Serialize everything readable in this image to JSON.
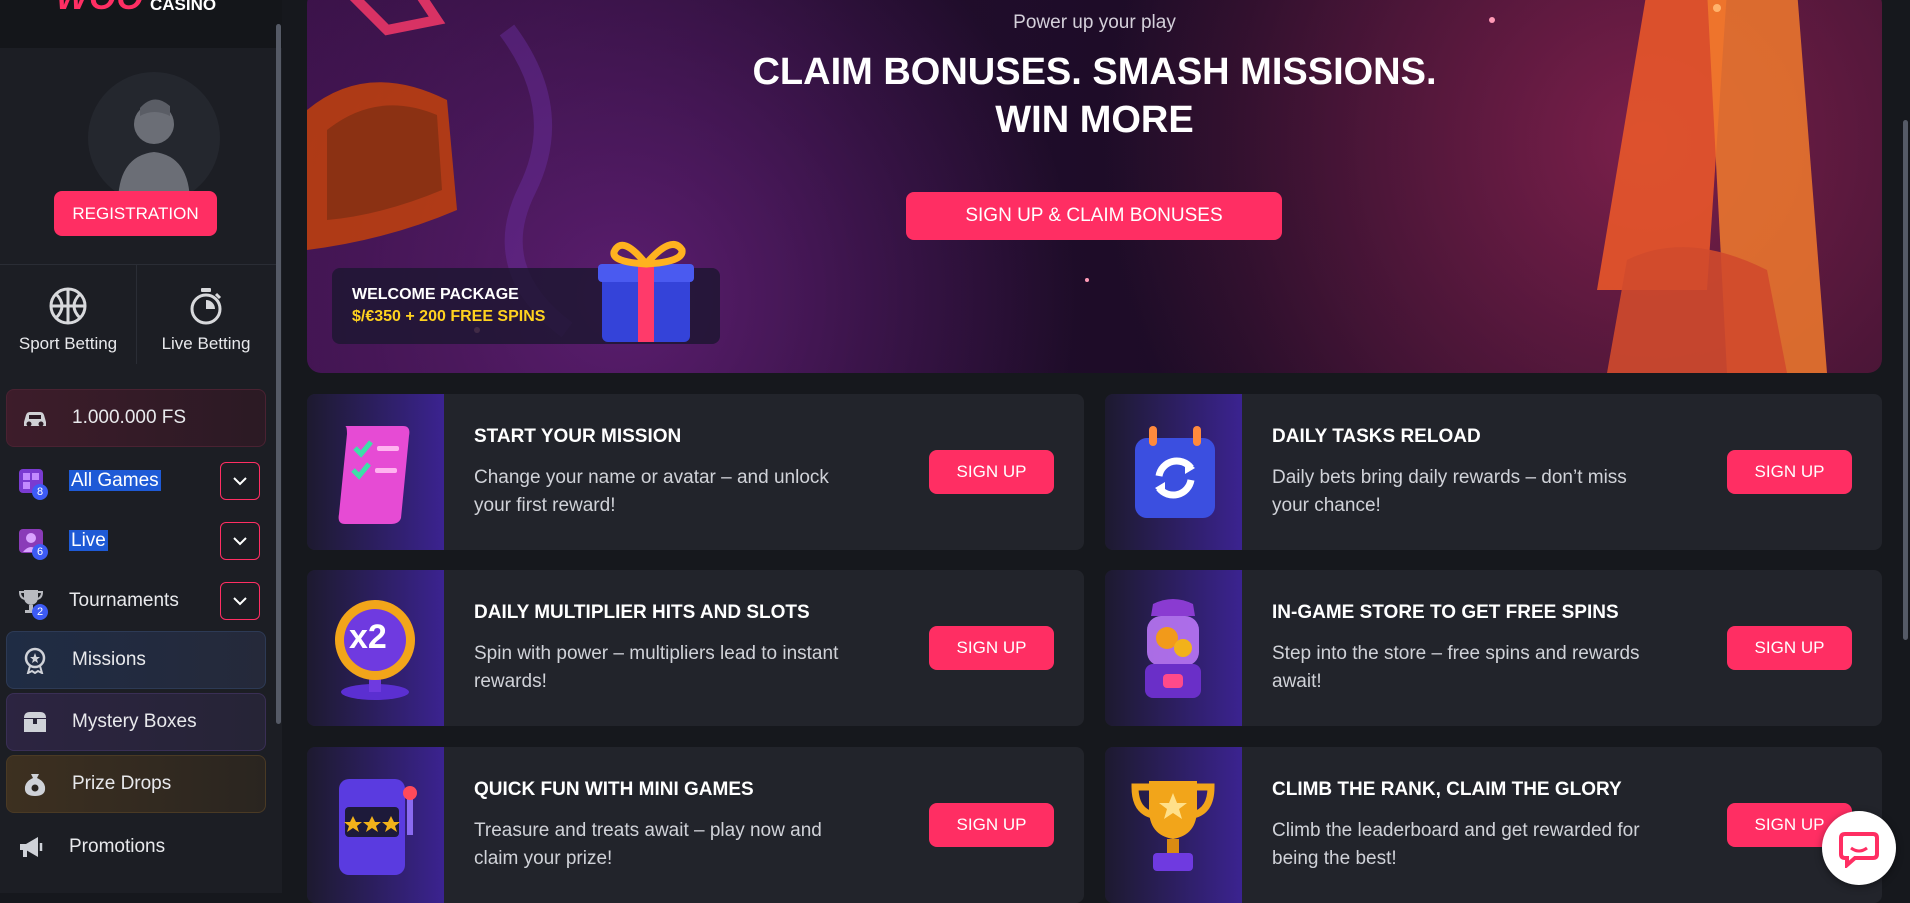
{
  "sidebar": {
    "logo_main": "WOO",
    "logo_sub": "CASINO",
    "registration_label": "REGISTRATION",
    "betting": [
      {
        "label": "Sport Betting",
        "icon": "basketball-icon"
      },
      {
        "label": "Live Betting",
        "icon": "stopwatch-icon"
      }
    ],
    "items": [
      {
        "label": "1.000.000 FS",
        "icon": "car-icon"
      },
      {
        "label": "All Games",
        "icon": "games-icon",
        "badge": "8",
        "selected": true
      },
      {
        "label": "Live",
        "icon": "live-icon",
        "badge": "6",
        "selected": true
      },
      {
        "label": "Tournaments",
        "icon": "trophy-icon",
        "badge": "2"
      },
      {
        "label": "Missions",
        "icon": "medal-icon"
      },
      {
        "label": "Mystery Boxes",
        "icon": "chest-icon"
      },
      {
        "label": "Prize Drops",
        "icon": "bag-icon"
      },
      {
        "label": "Promotions",
        "icon": "megaphone-icon"
      }
    ]
  },
  "hero": {
    "subtitle": "Power up your play",
    "title_line1": "CLAIM BONUSES. SMASH MISSIONS.",
    "title_line2": "WIN MORE",
    "cta": "SIGN UP & CLAIM BONUSES",
    "welcome_title": "WELCOME PACKAGE",
    "welcome_offer": "$/€350 + 200 FREE SPINS"
  },
  "cards": [
    {
      "title": "START YOUR MISSION",
      "desc": "Change your name or avatar – and unlock your first reward!",
      "button": "SIGN UP",
      "icon": "checklist-scroll-icon"
    },
    {
      "title": "DAILY TASKS RELOAD",
      "desc": "Daily bets bring daily rewards – don’t miss your chance!",
      "button": "SIGN UP",
      "icon": "calendar-reload-icon"
    },
    {
      "title": "DAILY MULTIPLIER HITS AND SLOTS",
      "desc": "Spin with power – multipliers lead to instant rewards!",
      "button": "SIGN UP",
      "icon": "x2-multiplier-icon"
    },
    {
      "title": "IN-GAME STORE TO GET FREE SPINS",
      "desc": "Step into the store – free spins and rewards await!",
      "button": "SIGN UP",
      "icon": "coin-machine-icon"
    },
    {
      "title": "QUICK FUN WITH MINI GAMES",
      "desc": "Treasure and treats await – play now and claim your prize!",
      "button": "SIGN UP",
      "icon": "slot-machine-icon"
    },
    {
      "title": "CLIMB THE RANK, CLAIM THE GLORY",
      "desc": "Climb the leaderboard and get rewarded for being the best!",
      "button": "SIGN UP",
      "icon": "gold-trophy-icon"
    }
  ],
  "colors": {
    "accent": "#ff2e63",
    "offer": "#ffd21f",
    "badge": "#3d5bf5",
    "background": "#16181d"
  }
}
